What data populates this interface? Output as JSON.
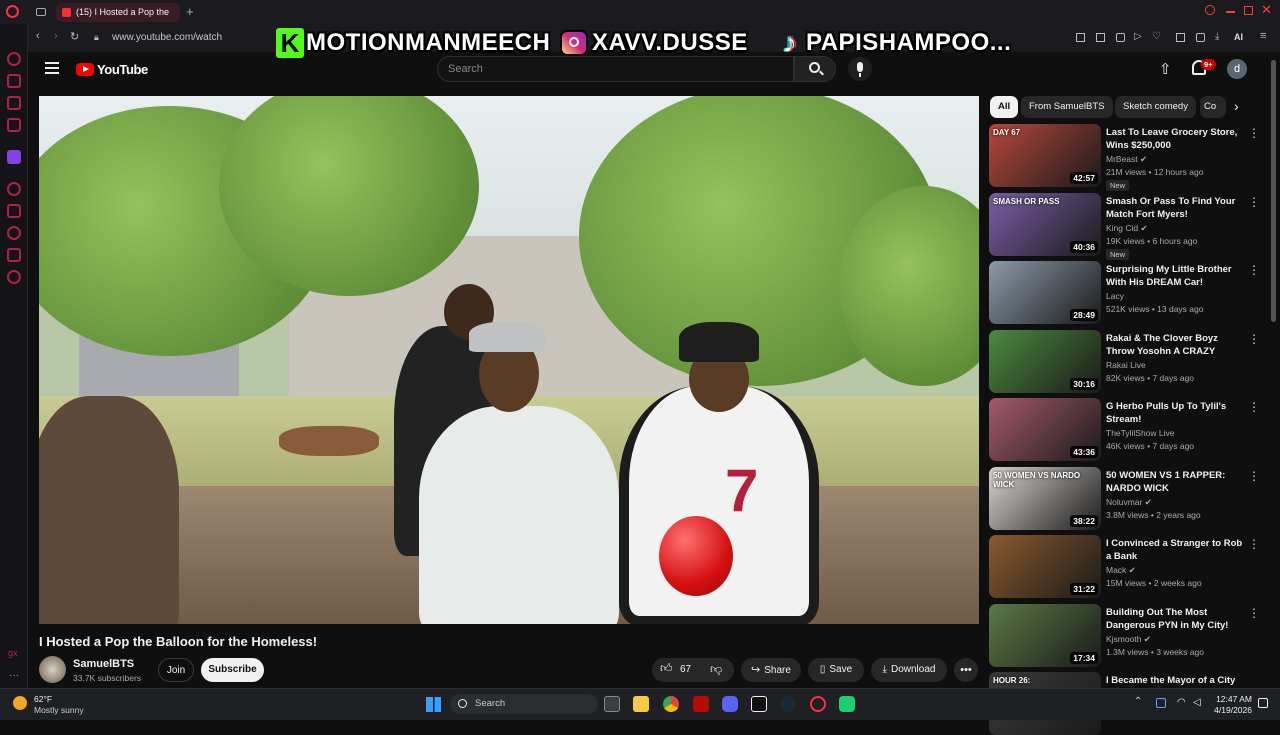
{
  "browser": {
    "tab_title": "(15) I Hosted a Pop the",
    "url": "www.youtube.com/watch",
    "ai_label": "AI"
  },
  "overlay": {
    "kick_handle": "MOTIONMANMEECH",
    "kick_letter": "K",
    "instagram_handle": "XAVV.DUSSE",
    "tiktok_handle": "PAPISHAMPOO..."
  },
  "youtube": {
    "logo": "YouTube",
    "search_placeholder": "Search",
    "notifications_count": "9+",
    "account_initial": "d"
  },
  "video": {
    "title": "I Hosted a Pop the Balloon for the Homeless!",
    "channel": "SamuelBTS",
    "subscribers": "33.7K subscribers",
    "join_label": "Join",
    "subscribe_label": "Subscribe",
    "likes": "67",
    "share_label": "Share",
    "save_label": "Save",
    "download_label": "Download",
    "jersey_number": "7"
  },
  "chips": [
    "All",
    "From SamuelBTS",
    "Sketch comedy",
    "Co"
  ],
  "recommendations": [
    {
      "title": "Last To Leave Grocery Store, Wins $250,000",
      "channel": "MrBeast",
      "verified": true,
      "meta": "21M views • 12 hours ago",
      "duration": "42:57",
      "new": true,
      "thumb_color": "#b9473c",
      "thumb_text": "DAY 67"
    },
    {
      "title": "Smash Or Pass To Find Your Match Fort Myers!",
      "channel": "King Cid",
      "verified": true,
      "meta": "19K views • 6 hours ago",
      "duration": "40:36",
      "new": true,
      "thumb_color": "#7a5fa8",
      "thumb_text": "SMASH OR PASS"
    },
    {
      "title": "Surprising My Little Brother With His DREAM Car!",
      "channel": "Lacy",
      "verified": false,
      "meta": "521K views • 13 days ago",
      "duration": "28:49",
      "new": false,
      "thumb_color": "#8c9aa8",
      "thumb_text": ""
    },
    {
      "title": "Rakai & The Clover Boyz Throw Yosohn A CRAZY Birthday Par...",
      "channel": "Rakai Live",
      "verified": false,
      "meta": "82K views • 7 days ago",
      "duration": "30:16",
      "new": false,
      "thumb_color": "#4c8a3f",
      "thumb_text": ""
    },
    {
      "title": "G Herbo Pulls Up To Tylil's Stream!",
      "channel": "TheTylilShow Live",
      "verified": false,
      "meta": "46K views • 7 days ago",
      "duration": "43:36",
      "new": false,
      "thumb_color": "#a55a6a",
      "thumb_text": ""
    },
    {
      "title": "50 WOMEN VS 1 RAPPER: NARDO WICK",
      "channel": "Noluvmar",
      "verified": true,
      "meta": "3.8M views • 2 years ago",
      "duration": "38:22",
      "new": false,
      "thumb_color": "#d9d4d0",
      "thumb_text": "50 WOMEN VS NARDO WICK"
    },
    {
      "title": "I Convinced a Stranger to Rob a Bank",
      "channel": "Mack",
      "verified": true,
      "meta": "15M views • 2 weeks ago",
      "duration": "31:22",
      "new": false,
      "thumb_color": "#8a5a2e",
      "thumb_text": ""
    },
    {
      "title": "Building Out The Most Dangerous PYN in My City!",
      "channel": "Kjsmooth",
      "verified": true,
      "meta": "1.3M views • 3 weeks ago",
      "duration": "17:34",
      "new": false,
      "thumb_color": "#5a7a46",
      "thumb_text": ""
    },
    {
      "title": "I Became the Mayor of a City",
      "channel": "",
      "verified": false,
      "meta": "",
      "duration": "",
      "new": false,
      "thumb_color": "#3a3a3a",
      "thumb_text": "HOUR 26:"
    }
  ],
  "taskbar": {
    "weather_temp": "62°F",
    "weather_desc": "Mostly sunny",
    "search_label": "Search",
    "time": "12:47 AM",
    "date": "4/19/2026"
  }
}
